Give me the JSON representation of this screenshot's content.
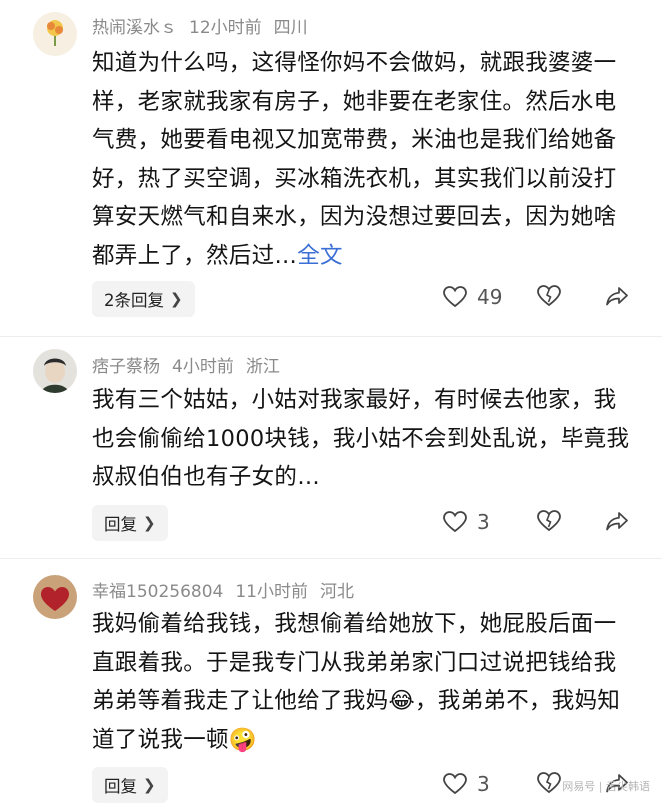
{
  "comments": [
    {
      "username": "热闹溪水ｓ",
      "time": "12小时前",
      "location": "四川",
      "text": "知道为什么吗，这得怪你妈不会做妈，就跟我婆婆一样，老家就我家有房子，她非要在老家住。然后水电气费，她要看电视又加宽带费，米油也是我们给她备好，热了买空调，买冰箱洗衣机，其实我们以前没打算安天燃气和自来水，因为没想过要回去，因为她啥都弄上了，然后过…",
      "more_label": "全文",
      "reply_label": "2条回复",
      "likes": "49",
      "avatar_colors": [
        "#f2c64a",
        "#e8893a"
      ]
    },
    {
      "username": "痞子蔡杨",
      "time": "4小时前",
      "location": "浙江",
      "text": "我有三个姑姑，小姑对我家最好，有时候去他家，我也会偷偷给1000块钱，我小姑不会到处乱说，毕竟我叔叔伯伯也有子女的…",
      "reply_label": "回复",
      "likes": "3",
      "avatar_colors": [
        "#d9d6cf",
        "#3a3a3a"
      ]
    },
    {
      "username": "幸福150256804",
      "time": "11小时前",
      "location": "河北",
      "text": "我妈偷着给我钱，我想偷着给她放下，她屁股后面一直跟着我。于是我专门从我弟弟家门口过说把钱给我弟弟等着我走了让他给了我妈😂，我弟弟不，我妈知道了说我一顿🤪",
      "reply_label": "回复",
      "likes": "3",
      "avatar_colors": [
        "#c9a27a",
        "#b2222a"
      ]
    }
  ],
  "watermark": "网易号 | 舌尖韩语"
}
